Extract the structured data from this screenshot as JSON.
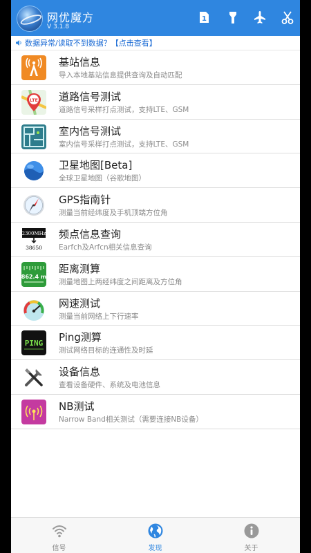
{
  "header": {
    "title": "网优魔方",
    "version": "V 3.1.8",
    "accent": "#2f86e0",
    "icons": [
      "sim-1-icon",
      "flashlight-icon",
      "airplane-mode-icon",
      "scissors-icon"
    ],
    "sim_label": "1"
  },
  "notice": {
    "text": "数据异常/读取不到数据？【点击查看】"
  },
  "list": [
    {
      "title": "基站信息",
      "subtitle": "导入本地基站信息提供查询及自动匹配",
      "icon": "cell-tower-icon"
    },
    {
      "title": "道路信号测试",
      "subtitle": "道路信号采样打点测试，支持LTE、GSM",
      "icon": "lte-map-pin-icon",
      "icon_text": "LTE"
    },
    {
      "title": "室内信号测试",
      "subtitle": "室内信号采样打点测试，支持LTE、GSM",
      "icon": "floor-plan-icon"
    },
    {
      "title": "卫星地图[Beta]",
      "subtitle": "全球卫星地图（谷歌地图）",
      "icon": "earth-icon"
    },
    {
      "title": "GPS指南针",
      "subtitle": "测量当前经纬度及手机顶端方位角",
      "icon": "compass-icon"
    },
    {
      "title": "频点信息查询",
      "subtitle": "Earfch及Arfcn相关信息查询",
      "icon": "frequency-icon",
      "icon_top": "2300MHz",
      "icon_bottom": "38650"
    },
    {
      "title": "距离测算",
      "subtitle": "测量地图上两经纬度之间距离及方位角",
      "icon": "distance-icon",
      "icon_text": "862.4 m"
    },
    {
      "title": "网速测试",
      "subtitle": "测量当前网络上下行速率",
      "icon": "speedometer-icon"
    },
    {
      "title": "Ping测算",
      "subtitle": "测试网络目标的连通性及时延",
      "icon": "ping-icon",
      "icon_text": "PING"
    },
    {
      "title": "设备信息",
      "subtitle": "查看设备硬件、系统及电池信息",
      "icon": "tools-icon"
    },
    {
      "title": "NB测试",
      "subtitle": "Narrow Band相关测试（需要连接NB设备）",
      "icon": "nb-signal-icon"
    }
  ],
  "nav": {
    "tabs": [
      {
        "label": "信号",
        "icon": "wifi-icon",
        "active": false
      },
      {
        "label": "发现",
        "icon": "globe-icon",
        "active": true
      },
      {
        "label": "关于",
        "icon": "info-icon",
        "active": false
      }
    ],
    "active_color": "#2f86e0",
    "inactive_color": "#888888"
  }
}
